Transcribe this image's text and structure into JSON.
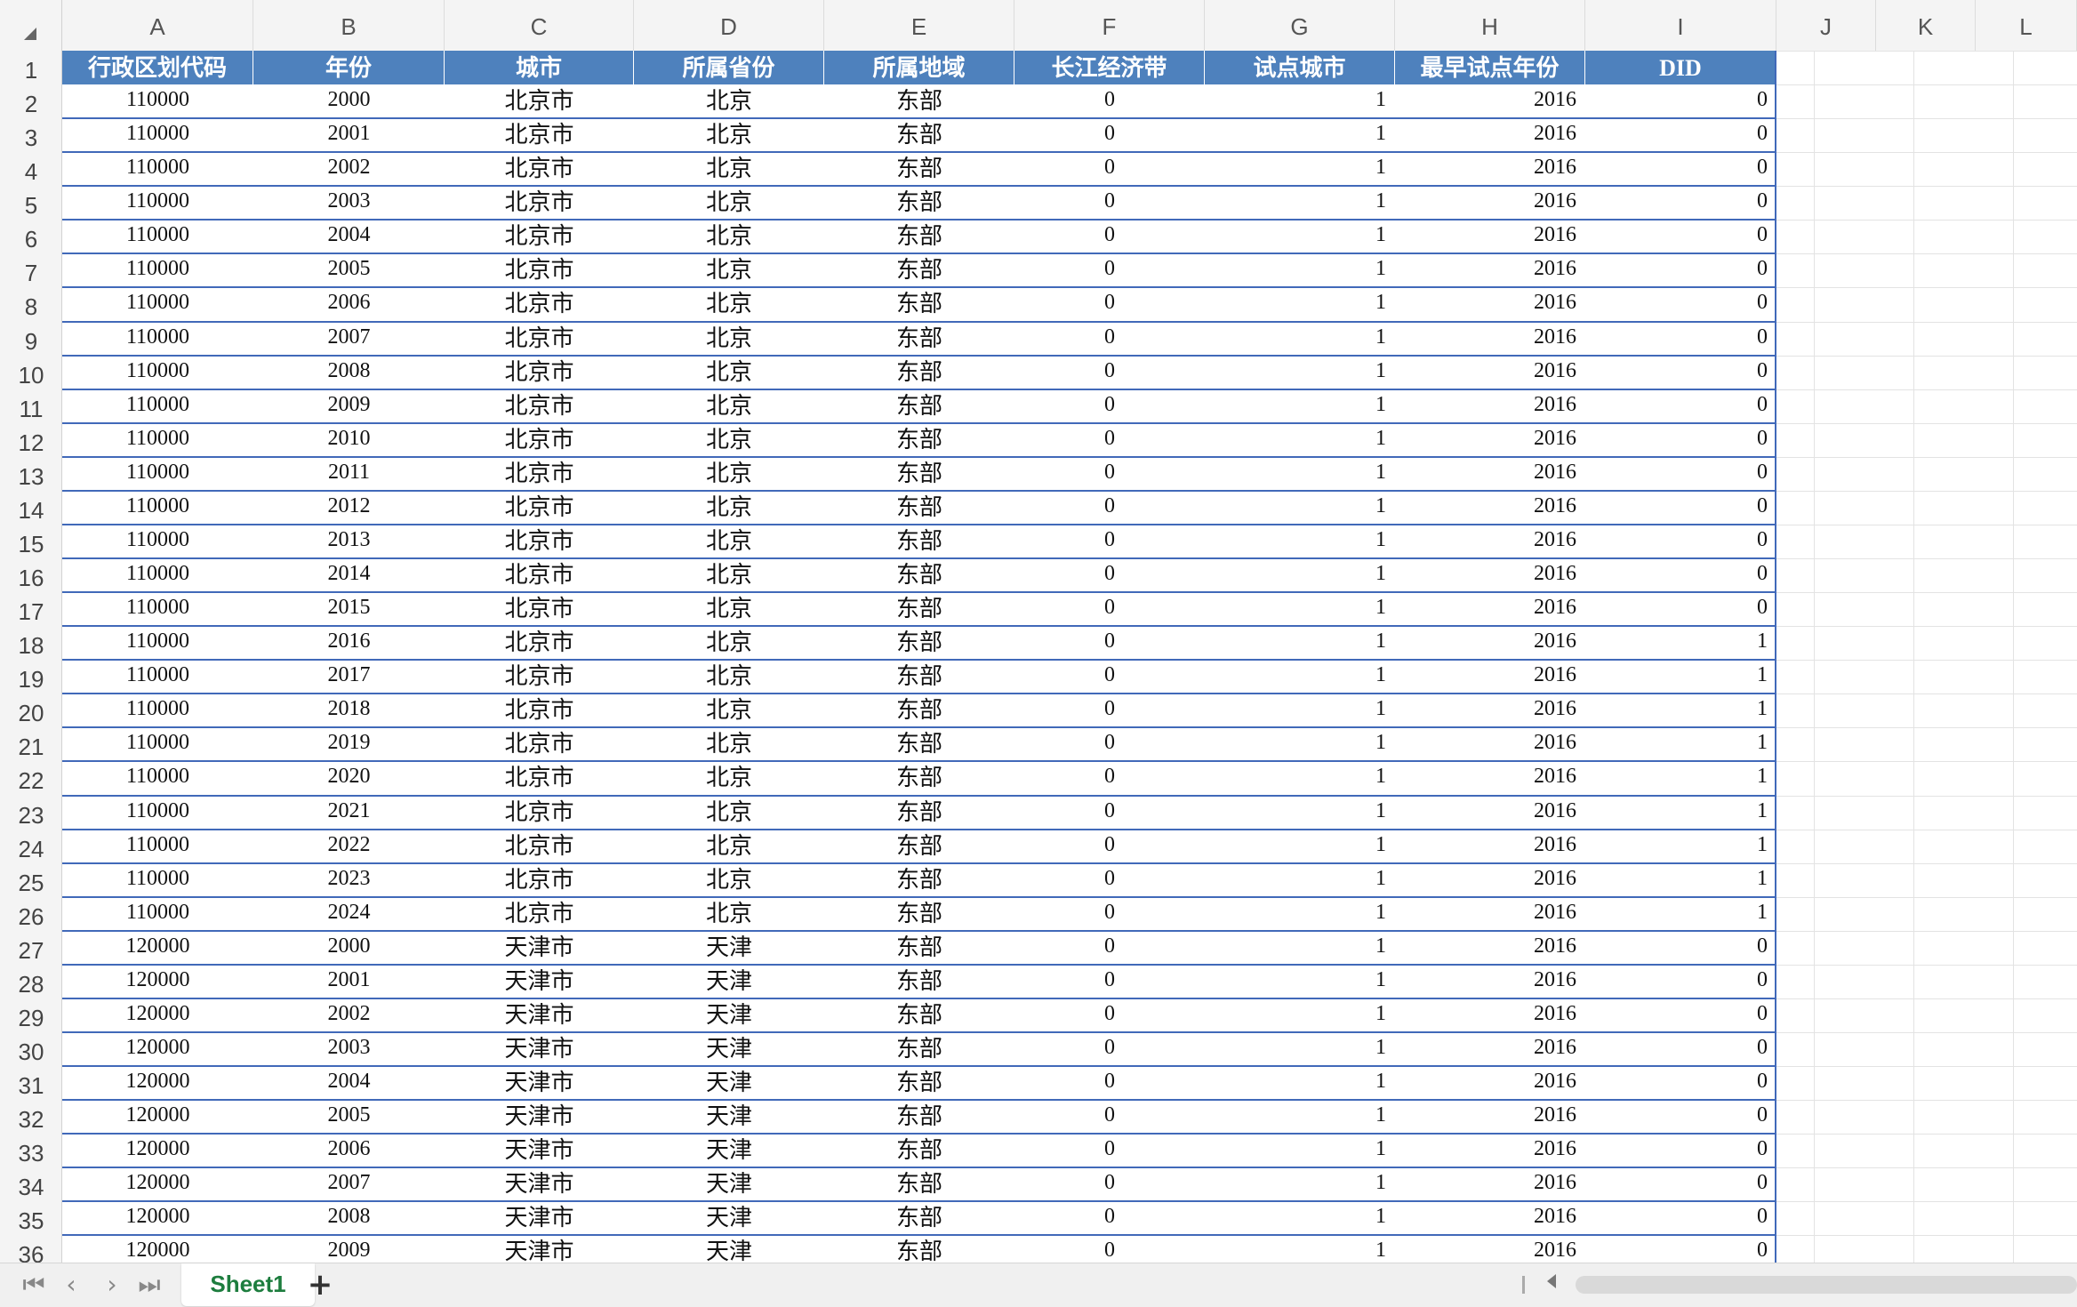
{
  "columns": [
    "A",
    "B",
    "C",
    "D",
    "E",
    "F",
    "G",
    "H",
    "I",
    "J",
    "K",
    "L"
  ],
  "headers": [
    "行政区划代码",
    "年份",
    "城市",
    "所属省份",
    "所属地域",
    "长江经济带",
    "试点城市",
    "最早试点年份",
    "DID"
  ],
  "rows": [
    [
      "110000",
      "2000",
      "北京市",
      "北京",
      "东部",
      "0",
      "1",
      "2016",
      "0"
    ],
    [
      "110000",
      "2001",
      "北京市",
      "北京",
      "东部",
      "0",
      "1",
      "2016",
      "0"
    ],
    [
      "110000",
      "2002",
      "北京市",
      "北京",
      "东部",
      "0",
      "1",
      "2016",
      "0"
    ],
    [
      "110000",
      "2003",
      "北京市",
      "北京",
      "东部",
      "0",
      "1",
      "2016",
      "0"
    ],
    [
      "110000",
      "2004",
      "北京市",
      "北京",
      "东部",
      "0",
      "1",
      "2016",
      "0"
    ],
    [
      "110000",
      "2005",
      "北京市",
      "北京",
      "东部",
      "0",
      "1",
      "2016",
      "0"
    ],
    [
      "110000",
      "2006",
      "北京市",
      "北京",
      "东部",
      "0",
      "1",
      "2016",
      "0"
    ],
    [
      "110000",
      "2007",
      "北京市",
      "北京",
      "东部",
      "0",
      "1",
      "2016",
      "0"
    ],
    [
      "110000",
      "2008",
      "北京市",
      "北京",
      "东部",
      "0",
      "1",
      "2016",
      "0"
    ],
    [
      "110000",
      "2009",
      "北京市",
      "北京",
      "东部",
      "0",
      "1",
      "2016",
      "0"
    ],
    [
      "110000",
      "2010",
      "北京市",
      "北京",
      "东部",
      "0",
      "1",
      "2016",
      "0"
    ],
    [
      "110000",
      "2011",
      "北京市",
      "北京",
      "东部",
      "0",
      "1",
      "2016",
      "0"
    ],
    [
      "110000",
      "2012",
      "北京市",
      "北京",
      "东部",
      "0",
      "1",
      "2016",
      "0"
    ],
    [
      "110000",
      "2013",
      "北京市",
      "北京",
      "东部",
      "0",
      "1",
      "2016",
      "0"
    ],
    [
      "110000",
      "2014",
      "北京市",
      "北京",
      "东部",
      "0",
      "1",
      "2016",
      "0"
    ],
    [
      "110000",
      "2015",
      "北京市",
      "北京",
      "东部",
      "0",
      "1",
      "2016",
      "0"
    ],
    [
      "110000",
      "2016",
      "北京市",
      "北京",
      "东部",
      "0",
      "1",
      "2016",
      "1"
    ],
    [
      "110000",
      "2017",
      "北京市",
      "北京",
      "东部",
      "0",
      "1",
      "2016",
      "1"
    ],
    [
      "110000",
      "2018",
      "北京市",
      "北京",
      "东部",
      "0",
      "1",
      "2016",
      "1"
    ],
    [
      "110000",
      "2019",
      "北京市",
      "北京",
      "东部",
      "0",
      "1",
      "2016",
      "1"
    ],
    [
      "110000",
      "2020",
      "北京市",
      "北京",
      "东部",
      "0",
      "1",
      "2016",
      "1"
    ],
    [
      "110000",
      "2021",
      "北京市",
      "北京",
      "东部",
      "0",
      "1",
      "2016",
      "1"
    ],
    [
      "110000",
      "2022",
      "北京市",
      "北京",
      "东部",
      "0",
      "1",
      "2016",
      "1"
    ],
    [
      "110000",
      "2023",
      "北京市",
      "北京",
      "东部",
      "0",
      "1",
      "2016",
      "1"
    ],
    [
      "110000",
      "2024",
      "北京市",
      "北京",
      "东部",
      "0",
      "1",
      "2016",
      "1"
    ],
    [
      "120000",
      "2000",
      "天津市",
      "天津",
      "东部",
      "0",
      "1",
      "2016",
      "0"
    ],
    [
      "120000",
      "2001",
      "天津市",
      "天津",
      "东部",
      "0",
      "1",
      "2016",
      "0"
    ],
    [
      "120000",
      "2002",
      "天津市",
      "天津",
      "东部",
      "0",
      "1",
      "2016",
      "0"
    ],
    [
      "120000",
      "2003",
      "天津市",
      "天津",
      "东部",
      "0",
      "1",
      "2016",
      "0"
    ],
    [
      "120000",
      "2004",
      "天津市",
      "天津",
      "东部",
      "0",
      "1",
      "2016",
      "0"
    ],
    [
      "120000",
      "2005",
      "天津市",
      "天津",
      "东部",
      "0",
      "1",
      "2016",
      "0"
    ],
    [
      "120000",
      "2006",
      "天津市",
      "天津",
      "东部",
      "0",
      "1",
      "2016",
      "0"
    ],
    [
      "120000",
      "2007",
      "天津市",
      "天津",
      "东部",
      "0",
      "1",
      "2016",
      "0"
    ],
    [
      "120000",
      "2008",
      "天津市",
      "天津",
      "东部",
      "0",
      "1",
      "2016",
      "0"
    ],
    [
      "120000",
      "2009",
      "天津市",
      "天津",
      "东部",
      "0",
      "1",
      "2016",
      "0"
    ]
  ],
  "sheet_tabs": [
    "Sheet1"
  ],
  "add_sheet_label": "+",
  "nav": {
    "first": "⏮",
    "prev": "‹",
    "next": "›",
    "last": "⏭"
  },
  "colors": {
    "header_fill": "#4e81bd",
    "header_text": "#ffffff",
    "row_border": "#4169b9",
    "tab_text": "#1d7d3e"
  }
}
